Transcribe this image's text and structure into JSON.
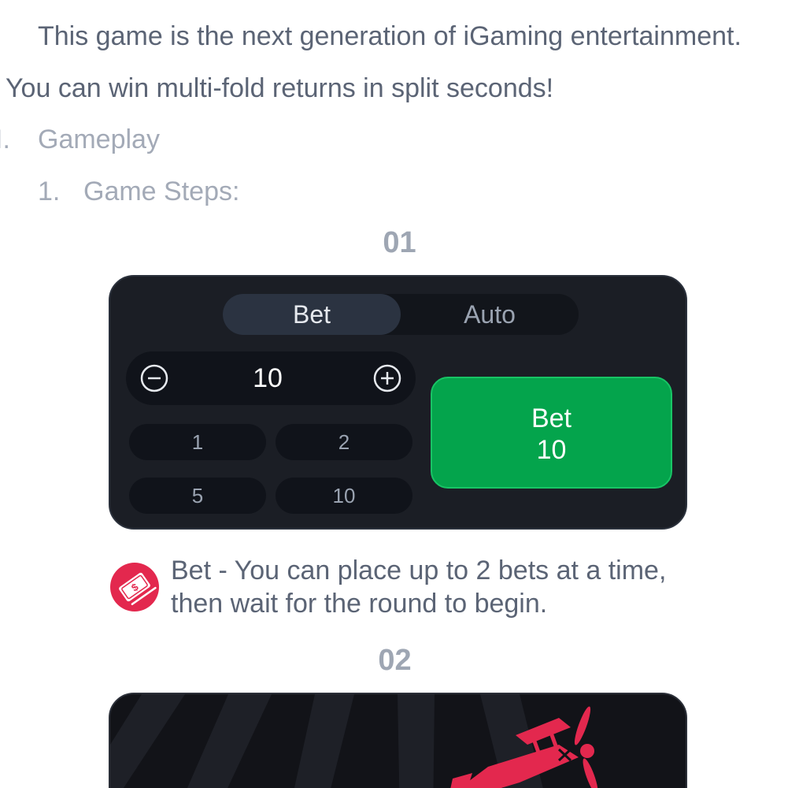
{
  "intro": {
    "line1": "This game is the next generation of iGaming entertainment.",
    "line2": "You can win multi-fold returns in split seconds!"
  },
  "section": {
    "number": "I.",
    "title": "Gameplay"
  },
  "subsection": {
    "number": "1.",
    "title": "Game Steps:"
  },
  "steps": [
    {
      "number": "01",
      "panel": {
        "tabs": [
          "Bet",
          "Auto"
        ],
        "active_tab": "Bet",
        "amount": "10",
        "quick_amounts": [
          "1",
          "2",
          "5",
          "10"
        ],
        "bet_button": {
          "line1": "Bet",
          "line2": "10"
        },
        "bet_button_color": "#04a44c"
      },
      "info": {
        "icon": "money-icon",
        "line1": "Bet - You can place up to 2 bets at a time,",
        "line2": "then wait for the round to begin."
      }
    },
    {
      "number": "02",
      "panel": {
        "icon": "airplane-icon",
        "accent_color": "#e3284e"
      }
    }
  ],
  "colors": {
    "text": "#5b6475",
    "muted": "#a3aab7",
    "panel_bg": "#1b1e25",
    "accent_red": "#e3284e"
  },
  "icons": {
    "minus": "minus-circle-icon",
    "plus": "plus-circle-icon"
  }
}
